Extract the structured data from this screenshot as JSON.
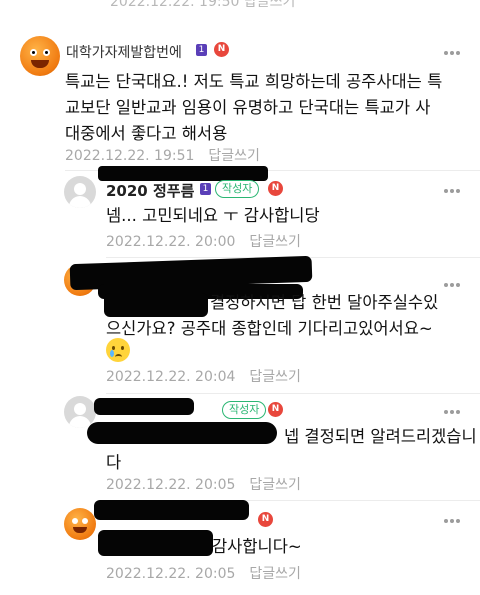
{
  "top_cut_text": "2022.12.22. 19:50 답글쓰기",
  "comments": [
    {
      "nickname": "대학가자제발합번에",
      "level_icon": "1",
      "new_badge": "N",
      "text_lines": [
        "특교는 단국대요.! 저도 특교 희망하는데 공주사대는 특",
        "교보단 일반교과 임용이 유명하고 단국대는 특교가 사",
        "대중에서 좋다고 해서용"
      ],
      "time": "2022.12.22. 19:51",
      "reply_label": "답글쓰기"
    },
    {
      "nickname": "2020 정푸름",
      "level_icon": "1",
      "author_badge": "작성자",
      "new_badge": "N",
      "text_lines": [
        "넴... 고민되네요 ㅜ 감사합니당"
      ],
      "time": "2022.12.22. 20:00",
      "reply_label": "답글쓰기"
    },
    {
      "text_lines": [
        "결정하시면 답 한번 달아주실수있",
        "으신가요? 공주대 종합인데 기다리고있어서요~"
      ],
      "emoji": "😢",
      "time": "2022.12.22. 20:04",
      "reply_label": "답글쓰기"
    },
    {
      "author_badge": "작성자",
      "new_badge": "N",
      "text_lines": [
        "넵 결정되면 알려드리겠습니",
        "다"
      ],
      "time": "2022.12.22. 20:05",
      "reply_label": "답글쓰기"
    },
    {
      "new_badge": "N",
      "text_lines": [
        "감사합니다~"
      ],
      "time": "2022.12.22. 20:05",
      "reply_label": "답글쓰기"
    }
  ]
}
